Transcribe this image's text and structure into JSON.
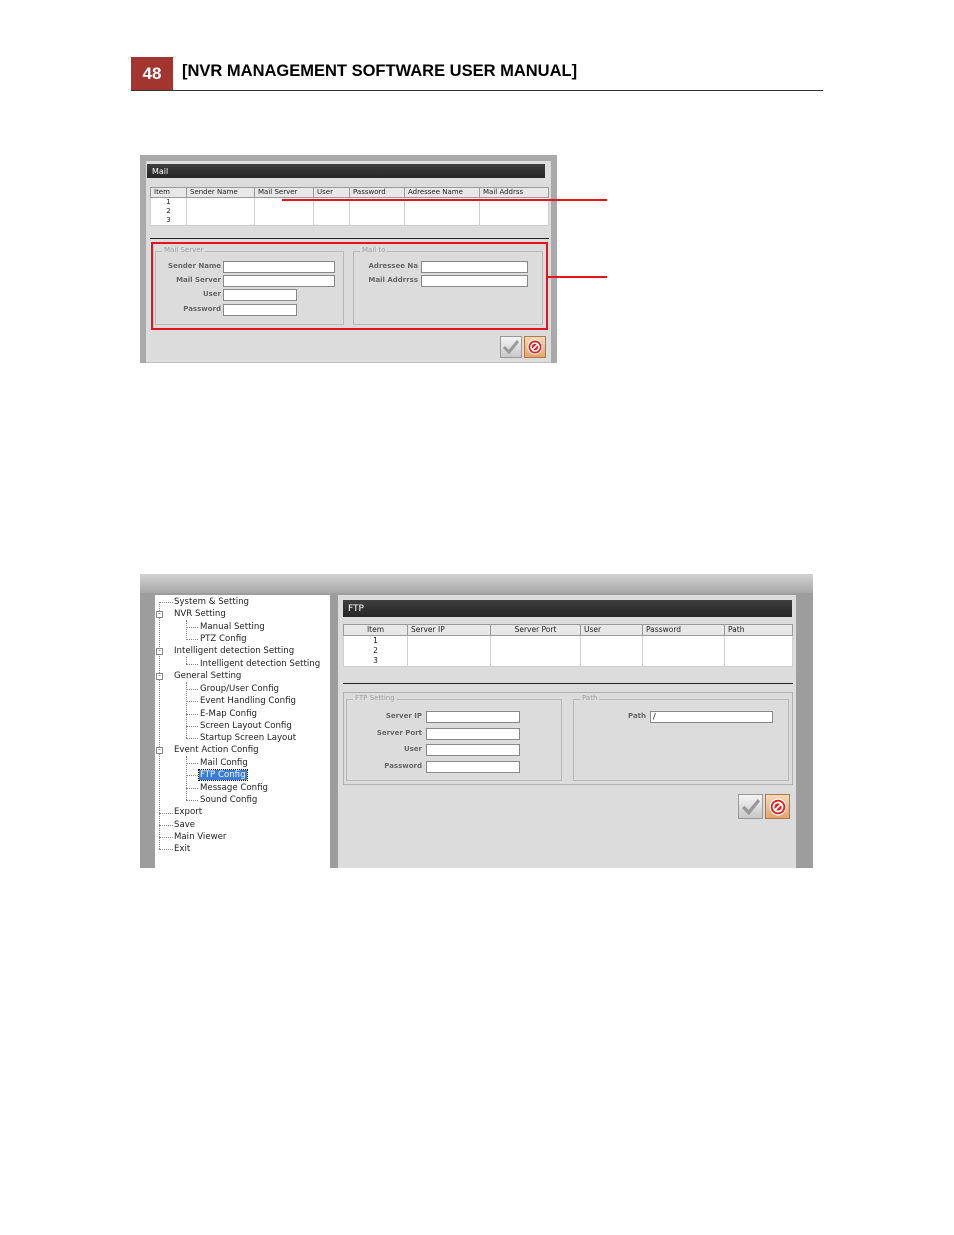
{
  "header": {
    "page_number": "48",
    "title": "[NVR MANAGEMENT SOFTWARE USER MANUAL]"
  },
  "mail_window": {
    "title": "Mail",
    "columns": [
      "Item",
      "Sender Name",
      "Mail Server",
      "User",
      "Password",
      "Adressee Name",
      "Mail Addrss"
    ],
    "rows": [
      [
        "1",
        "",
        "",
        "",
        "",
        "",
        ""
      ],
      [
        "2",
        "",
        "",
        "",
        "",
        "",
        ""
      ],
      [
        "3",
        "",
        "",
        "",
        "",
        "",
        ""
      ]
    ],
    "mail_server_group": {
      "legend": "Mail Server",
      "fields": [
        {
          "label": "Sender Name",
          "value": ""
        },
        {
          "label": "Mail Server",
          "value": ""
        },
        {
          "label": "User",
          "value": ""
        },
        {
          "label": "Password",
          "value": ""
        }
      ]
    },
    "mail_to_group": {
      "legend": "Mail to",
      "fields": [
        {
          "label": "Adressee Na",
          "value": ""
        },
        {
          "label": "Mail Addrrss",
          "value": ""
        }
      ]
    }
  },
  "tree": {
    "items": [
      "System & Setting",
      "NVR  Setting",
      "Manual Setting",
      "PTZ Config",
      "Intelligent detection Setting",
      "Intelligent detection Setting",
      "General Setting",
      "Group/User Config",
      "Event Handling Config",
      "E-Map Config",
      "Screen Layout Config",
      "Startup Screen Layout",
      "Event Action Config",
      "Mail Config",
      "FTP Config",
      "Message Config",
      "Sound Config",
      "Export",
      "Save",
      "Main Viewer",
      "Exit"
    ],
    "selected": "FTP Config"
  },
  "ftp_window": {
    "title": "FTP",
    "columns": [
      "Item",
      "Server IP",
      "Server Port",
      "User",
      "Password",
      "Path"
    ],
    "rows": [
      [
        "1",
        "",
        "",
        "",
        "",
        ""
      ],
      [
        "2",
        "",
        "",
        "",
        "",
        ""
      ],
      [
        "3",
        "",
        "",
        "",
        "",
        ""
      ]
    ],
    "ftp_setting_group": {
      "legend": "FTP Setting",
      "fields": [
        {
          "label": "Server IP",
          "value": ""
        },
        {
          "label": "Server Port",
          "value": ""
        },
        {
          "label": "User",
          "value": ""
        },
        {
          "label": "Password",
          "value": ""
        }
      ]
    },
    "path_group": {
      "legend": "Path",
      "fields": [
        {
          "label": "Path",
          "value": "/"
        }
      ]
    }
  },
  "icons": {
    "confirm": "checkmark-icon",
    "cancel": "no-entry-icon"
  },
  "colors": {
    "page_badge": "#a33530",
    "highlight": "#e3141b",
    "tree_selection": "#3d7bd8"
  }
}
